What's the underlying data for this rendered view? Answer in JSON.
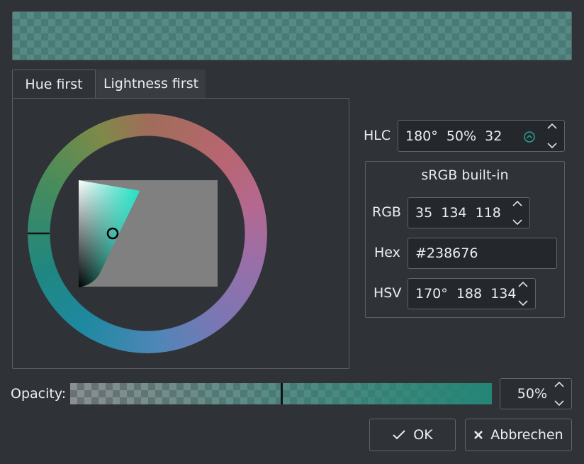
{
  "colors": {
    "current": "#238676",
    "opacity": 0.5
  },
  "tabs": {
    "hue_first": "Hue first",
    "lightness_first": "Lightness first"
  },
  "hlc": {
    "label": "HLC",
    "value": "180°  50%  32"
  },
  "color_space": {
    "title": "sRGB built-in"
  },
  "rgb": {
    "label": "RGB",
    "value": "35  134  118"
  },
  "hex": {
    "label": "Hex",
    "value": "#238676"
  },
  "hsv": {
    "label": "HSV",
    "value": "170°  188  134"
  },
  "opacity": {
    "label": "Opacity:",
    "value": "50%",
    "level": 0.5
  },
  "buttons": {
    "ok": "OK",
    "cancel": "Abbrechen"
  },
  "icons": {
    "hlc_indicator": "gamut-indicator-icon",
    "ok": "checkmark-icon",
    "cancel": "close-icon",
    "spin": "chevron-up-down-icon"
  }
}
